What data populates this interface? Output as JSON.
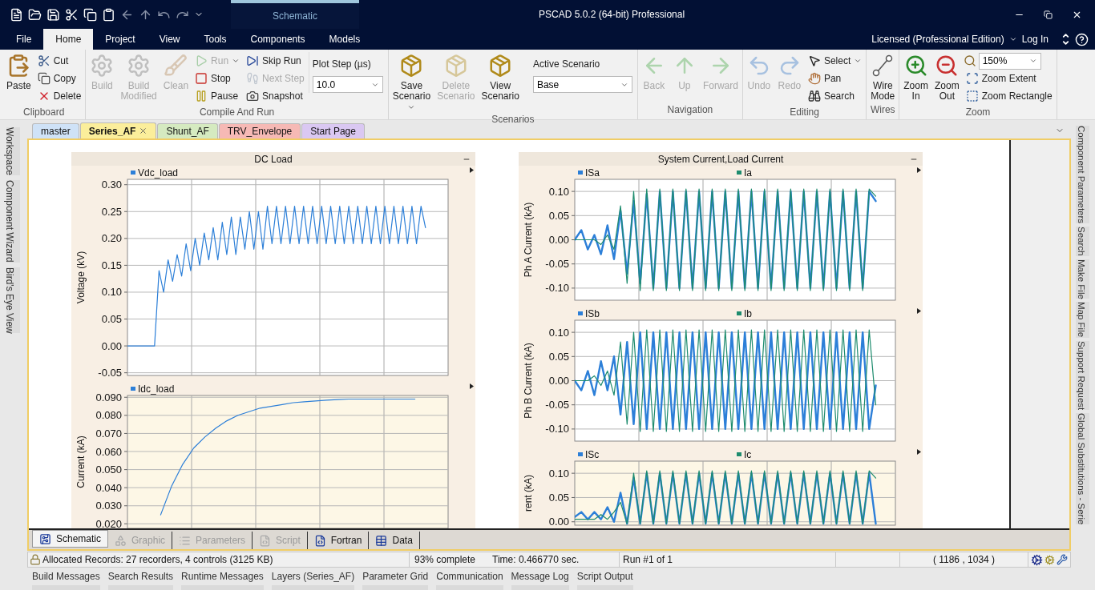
{
  "title_bar": {
    "context_tab": "Schematic",
    "title": "PSCAD 5.0.2 (64-bit) Professional"
  },
  "menu_tabs": [
    {
      "label": "File",
      "selected": false
    },
    {
      "label": "Home",
      "selected": true
    },
    {
      "label": "Project",
      "selected": false
    },
    {
      "label": "View",
      "selected": false
    },
    {
      "label": "Tools",
      "selected": false
    },
    {
      "label": "Components",
      "selected": false
    },
    {
      "label": "Models",
      "selected": false
    }
  ],
  "account": {
    "license": "Licensed (Professional Edition)",
    "login": "Log In"
  },
  "ribbon": {
    "groups": [
      {
        "label": "Clipboard",
        "items": [
          {
            "kind": "large",
            "label": "Paste",
            "disabled": false,
            "menu": false
          },
          {
            "kind": "column",
            "items": [
              {
                "kind": "small",
                "label": "Cut",
                "disabled": false,
                "menu": false
              },
              {
                "kind": "small",
                "label": "Copy",
                "disabled": false,
                "menu": false
              },
              {
                "kind": "small",
                "label": "Delete",
                "disabled": false,
                "menu": false
              }
            ]
          }
        ]
      },
      {
        "label": "Compile And Run",
        "items": [
          {
            "kind": "large",
            "label": "Build",
            "disabled": true,
            "menu": false
          },
          {
            "kind": "large",
            "label": "Build Modified",
            "disabled": true,
            "menu": false
          },
          {
            "kind": "large",
            "label": "Clean",
            "disabled": true,
            "menu": false
          },
          {
            "kind": "column",
            "items": [
              {
                "kind": "small",
                "label": "Run",
                "disabled": true,
                "menu": true
              },
              {
                "kind": "small",
                "label": "Stop",
                "disabled": false,
                "menu": false
              },
              {
                "kind": "small",
                "label": "Pause",
                "disabled": false,
                "menu": false
              }
            ]
          },
          {
            "kind": "column",
            "items": [
              {
                "kind": "small",
                "label": "Skip Run",
                "disabled": false,
                "menu": false
              },
              {
                "kind": "small",
                "label": "Next Step",
                "disabled": true,
                "menu": false
              },
              {
                "kind": "small",
                "label": "Snapshot",
                "disabled": false,
                "menu": false
              }
            ]
          },
          {
            "kind": "field",
            "label": "Plot Step (µs)",
            "value": "10.0"
          }
        ]
      },
      {
        "label": "Scenarios",
        "items": [
          {
            "kind": "large",
            "label": "Save Scenario",
            "disabled": false,
            "menu": true
          },
          {
            "kind": "large",
            "label": "Delete Scenario",
            "disabled": true,
            "menu": false
          },
          {
            "kind": "large",
            "label": "View Scenario",
            "disabled": false,
            "menu": false
          },
          {
            "kind": "field",
            "label": "Active Scenario",
            "value": "Base"
          }
        ]
      },
      {
        "label": "Navigation",
        "items": [
          {
            "kind": "large",
            "label": "Back",
            "disabled": true,
            "menu": false
          },
          {
            "kind": "large",
            "label": "Up",
            "disabled": true,
            "menu": false
          },
          {
            "kind": "large",
            "label": "Forward",
            "disabled": true,
            "menu": false
          }
        ]
      },
      {
        "label": "Editing",
        "items": [
          {
            "kind": "large",
            "label": "Undo",
            "disabled": true,
            "menu": false
          },
          {
            "kind": "large",
            "label": "Redo",
            "disabled": true,
            "menu": false
          },
          {
            "kind": "column",
            "items": [
              {
                "kind": "small",
                "label": "Select",
                "disabled": false,
                "menu": true
              },
              {
                "kind": "small",
                "label": "Pan",
                "disabled": false,
                "menu": false
              },
              {
                "kind": "small",
                "label": "Search",
                "disabled": false,
                "menu": false
              }
            ]
          }
        ]
      },
      {
        "label": "Wires",
        "items": [
          {
            "kind": "large",
            "label": "Wire Mode",
            "disabled": false,
            "menu": false
          }
        ]
      },
      {
        "label": "Zoom",
        "items": [
          {
            "kind": "large",
            "label": "Zoom In",
            "disabled": false,
            "menu": false
          },
          {
            "kind": "large",
            "label": "Zoom Out",
            "disabled": false,
            "menu": false
          },
          {
            "kind": "column",
            "items": [
              {
                "kind": "dropdown",
                "value": "150%"
              },
              {
                "kind": "small",
                "label": "Zoom Extent",
                "disabled": false,
                "menu": false
              },
              {
                "kind": "small",
                "label": "Zoom Rectangle",
                "disabled": false,
                "menu": false
              }
            ]
          }
        ]
      }
    ]
  },
  "doc_tabs": [
    {
      "label": "master",
      "selected": false,
      "color": "#cfe2f7"
    },
    {
      "label": "Series_AF",
      "selected": true,
      "color": "#fbee9b"
    },
    {
      "label": "Shunt_AF",
      "selected": false,
      "color": "#d5eac0"
    },
    {
      "label": "TRV_Envelope",
      "selected": false,
      "color": "#f6b9b5"
    },
    {
      "label": "Start Page",
      "selected": false,
      "color": "#dac8f2"
    }
  ],
  "left_sidebar": [
    "Workspace",
    "Component Wizard",
    "Bird's Eye View"
  ],
  "right_sidebar": [
    "Component Parameters",
    "Search",
    "Make File",
    "Map File",
    "Support Request",
    "Global Substitutions - Serie"
  ],
  "graph_frames": [
    {
      "title": "DC Load",
      "graphs": [
        {
          "selected": false,
          "chart_data": {
            "type": "line",
            "grid": true,
            "ylabel": "Voltage (kV)",
            "ylim": [
              -0.055,
              0.31
            ],
            "yticks": [
              {
                "value": 0.3,
                "label": "0.30"
              },
              {
                "value": 0.25,
                "label": "0.25"
              },
              {
                "value": 0.2,
                "label": "0.20"
              },
              {
                "value": 0.15,
                "label": "0.15"
              },
              {
                "value": 0.1,
                "label": "0.10"
              },
              {
                "value": 0.05,
                "label": "0.05"
              },
              {
                "value": 0,
                "label": "0.00"
              },
              {
                "value": -0.05,
                "label": "-0.05"
              }
            ],
            "series": [
              {
                "name": "Vdc_load",
                "color": "#2c7fd8",
                "values": [
                  0,
                  0,
                  0,
                  0,
                  0,
                  0,
                  0,
                  0.14,
                  0.1,
                  0.16,
                  0.12,
                  0.17,
                  0.13,
                  0.19,
                  0.14,
                  0.2,
                  0.15,
                  0.21,
                  0.16,
                  0.22,
                  0.16,
                  0.23,
                  0.17,
                  0.24,
                  0.17,
                  0.24,
                  0.18,
                  0.25,
                  0.18,
                  0.25,
                  0.18,
                  0.26,
                  0.19,
                  0.26,
                  0.19,
                  0.26,
                  0.19,
                  0.26,
                  0.19,
                  0.26,
                  0.19,
                  0.26,
                  0.19,
                  0.26,
                  0.19,
                  0.26,
                  0.19,
                  0.26,
                  0.19,
                  0.26,
                  0.19,
                  0.26,
                  0.19,
                  0.26,
                  0.19,
                  0.26,
                  0.19,
                  0.26,
                  0.19,
                  0.26,
                  0.19,
                  0.26,
                  0.19,
                  0.26,
                  0.19,
                  0.26,
                  0.22,
                  null,
                  null,
                  null,
                  null,
                  null
                ]
              }
            ]
          }
        },
        {
          "selected": true,
          "chart_data": {
            "type": "line",
            "grid": true,
            "ylabel": "Current (kA)",
            "ylim": [
              0.0175,
              0.091
            ],
            "yticks": [
              {
                "value": 0.09,
                "label": "0.090"
              },
              {
                "value": 0.08,
                "label": "0.080"
              },
              {
                "value": 0.07,
                "label": "0.070"
              },
              {
                "value": 0.06,
                "label": "0.060"
              },
              {
                "value": 0.05,
                "label": "0.050"
              },
              {
                "value": 0.04,
                "label": "0.040"
              },
              {
                "value": 0.03,
                "label": "0.030"
              },
              {
                "value": 0.02,
                "label": "0.020"
              }
            ],
            "series": [
              {
                "name": "Idc_load",
                "color": "#2c7fd8",
                "values": [
                  null,
                  null,
                  null,
                  0.025,
                  0.041,
                  0.053,
                  0.062,
                  0.068,
                  0.073,
                  0.077,
                  0.08,
                  0.082,
                  0.084,
                  0.085,
                  0.086,
                  0.087,
                  0.0875,
                  0.088,
                  0.0884,
                  0.0887,
                  0.089,
                  0.089,
                  0.089,
                  0.089,
                  0.089,
                  0.089,
                  0.089,
                  null,
                  null,
                  null
                ]
              }
            ]
          }
        }
      ]
    },
    {
      "title": "System Current,Load Current",
      "graphs": [
        {
          "selected": false,
          "chart_data": {
            "type": "line",
            "grid": true,
            "ylabel": "Ph A Current (kA)",
            "ylim": [
              -0.125,
              0.125
            ],
            "yticks": [
              {
                "value": 0.1,
                "label": "0.10"
              },
              {
                "value": 0.05,
                "label": "0.05"
              },
              {
                "value": 0,
                "label": "0.00"
              },
              {
                "value": -0.05,
                "label": "-0.05"
              },
              {
                "value": -0.1,
                "label": "-0.10"
              }
            ],
            "series": [
              {
                "name": "ISa",
                "color": "#2c7fd8",
                "values": [
                  0,
                  0.02,
                  -0.02,
                  0.01,
                  -0.03,
                  0.03,
                  -0.04,
                  0.06,
                  -0.07,
                  0.08,
                  -0.09,
                  0.095,
                  -0.1,
                  0.1,
                  -0.1,
                  0.1,
                  -0.1,
                  0.1,
                  -0.1,
                  0.1,
                  -0.1,
                  0.1,
                  -0.1,
                  0.1,
                  -0.1,
                  0.1,
                  -0.1,
                  0.1,
                  -0.1,
                  0.1,
                  -0.1,
                  0.1,
                  -0.1,
                  0.1,
                  -0.1,
                  0.1,
                  -0.1,
                  0.1,
                  -0.1,
                  0.1,
                  -0.1,
                  0.1,
                  -0.1,
                  0.1,
                  -0.1,
                  0.1,
                  0.08,
                  null,
                  null,
                  null
                ]
              },
              {
                "name": "Ia",
                "color": "#1e8c6e",
                "values": [
                  0,
                  0,
                  0,
                  0,
                  -0.01,
                  0.01,
                  -0.02,
                  0.07,
                  -0.09,
                  0.1,
                  -0.105,
                  0.105,
                  -0.105,
                  0.105,
                  -0.105,
                  0.105,
                  -0.105,
                  0.105,
                  -0.105,
                  0.105,
                  -0.105,
                  0.105,
                  -0.105,
                  0.105,
                  -0.105,
                  0.105,
                  -0.105,
                  0.105,
                  -0.105,
                  0.105,
                  -0.105,
                  0.105,
                  -0.105,
                  0.105,
                  -0.105,
                  0.105,
                  -0.105,
                  0.105,
                  -0.105,
                  0.105,
                  -0.105,
                  0.105,
                  -0.105,
                  0.105,
                  -0.105,
                  0.105,
                  0.09,
                  null,
                  null,
                  null
                ]
              }
            ]
          }
        },
        {
          "selected": false,
          "chart_data": {
            "type": "line",
            "grid": true,
            "ylabel": "Ph B Current (kA)",
            "ylim": [
              -0.125,
              0.125
            ],
            "yticks": [
              {
                "value": 0.1,
                "label": "0.10"
              },
              {
                "value": 0.05,
                "label": "0.05"
              },
              {
                "value": 0,
                "label": "0.00"
              },
              {
                "value": -0.05,
                "label": "-0.05"
              },
              {
                "value": -0.1,
                "label": "-0.10"
              }
            ],
            "series": [
              {
                "name": "ISb",
                "color": "#2c7fd8",
                "values": [
                  0,
                  -0.02,
                  0.02,
                  -0.03,
                  0.04,
                  -0.02,
                  0.05,
                  -0.07,
                  0.08,
                  -0.09,
                  0.1,
                  -0.1,
                  0.1,
                  -0.1,
                  0.1,
                  -0.1,
                  0.1,
                  -0.1,
                  0.1,
                  -0.1,
                  0.1,
                  -0.1,
                  0.1,
                  -0.1,
                  0.1,
                  -0.1,
                  0.1,
                  -0.1,
                  0.1,
                  -0.1,
                  0.1,
                  -0.1,
                  0.1,
                  -0.1,
                  0.1,
                  -0.1,
                  0.1,
                  -0.1,
                  0.1,
                  -0.1,
                  0.1,
                  -0.1,
                  0.1,
                  -0.1,
                  0.1,
                  -0.1,
                  -0.01,
                  null,
                  null,
                  null
                ]
              },
              {
                "name": "Ib",
                "color": "#1e8c6e",
                "values": [
                  0,
                  0,
                  0,
                  0.01,
                  -0.01,
                  0.02,
                  -0.03,
                  0.08,
                  -0.09,
                  0.1,
                  -0.105,
                  0.105,
                  -0.105,
                  0.105,
                  -0.105,
                  0.105,
                  -0.105,
                  0.105,
                  -0.105,
                  0.105,
                  -0.105,
                  0.105,
                  -0.105,
                  0.105,
                  -0.105,
                  0.105,
                  -0.105,
                  0.105,
                  -0.105,
                  0.105,
                  -0.105,
                  0.105,
                  -0.105,
                  0.105,
                  -0.105,
                  0.105,
                  -0.105,
                  0.105,
                  -0.105,
                  0.105,
                  -0.105,
                  0.105,
                  -0.105,
                  0.105,
                  -0.105,
                  0.105,
                  -0.05,
                  null,
                  null,
                  null
                ]
              }
            ]
          }
        },
        {
          "selected": true,
          "chart_data": {
            "type": "line",
            "grid": true,
            "ylabel": "rent (kA)",
            "ylim": [
              -0.007,
              0.125
            ],
            "yticks": [
              {
                "value": 0.1,
                "label": "0.10"
              },
              {
                "value": 0.05,
                "label": "0.05"
              },
              {
                "value": 0,
                "label": "0.00"
              }
            ],
            "series": [
              {
                "name": "ISc",
                "color": "#2c7fd8",
                "values": [
                  0.01,
                  0.02,
                  0.005,
                  0.02,
                  0.005,
                  0.03,
                  0.0,
                  0.06,
                  -0.004,
                  0.09,
                  -0.004,
                  0.1,
                  -0.004,
                  0.1,
                  -0.004,
                  0.1,
                  -0.004,
                  0.1,
                  -0.004,
                  0.1,
                  -0.004,
                  0.1,
                  -0.004,
                  0.1,
                  -0.004,
                  0.1,
                  -0.004,
                  0.1,
                  -0.004,
                  0.1,
                  -0.004,
                  0.1,
                  -0.004,
                  0.1,
                  -0.004,
                  0.1,
                  -0.004,
                  0.1,
                  -0.004,
                  0.1,
                  -0.004,
                  0.1,
                  -0.004,
                  0.1,
                  -0.004,
                  0.1,
                  -0.004,
                  null,
                  null,
                  null
                ]
              },
              {
                "name": "Ic",
                "color": "#1e8c6e",
                "values": [
                  0.005,
                  0.005,
                  0.005,
                  0.005,
                  0.015,
                  0.005,
                  0.02,
                  0.04,
                  -0.004,
                  0.1,
                  -0.004,
                  0.105,
                  -0.004,
                  0.105,
                  -0.004,
                  0.105,
                  -0.004,
                  0.105,
                  -0.004,
                  0.105,
                  -0.004,
                  0.105,
                  -0.004,
                  0.105,
                  -0.004,
                  0.105,
                  -0.004,
                  0.105,
                  -0.004,
                  0.105,
                  -0.004,
                  0.105,
                  -0.004,
                  0.105,
                  -0.004,
                  0.105,
                  -0.004,
                  0.105,
                  -0.004,
                  0.105,
                  -0.004,
                  0.105,
                  -0.004,
                  0.105,
                  -0.004,
                  0.105,
                  0.09,
                  null,
                  null,
                  null
                ]
              }
            ]
          }
        }
      ]
    }
  ],
  "view_tabs": [
    {
      "label": "Schematic",
      "selected": true,
      "disabled": false
    },
    {
      "label": "Graphic",
      "selected": false,
      "disabled": true
    },
    {
      "label": "Parameters",
      "selected": false,
      "disabled": true
    },
    {
      "label": "Script",
      "selected": false,
      "disabled": true
    },
    {
      "label": "Fortran",
      "selected": false,
      "disabled": false
    },
    {
      "label": "Data",
      "selected": false,
      "disabled": false
    }
  ],
  "status_bar": {
    "records": "Allocated Records: 27 recorders, 4 controls (3125 KB)",
    "progress": "93% complete",
    "time": "Time: 0.466770 sec.",
    "run": "Run #1 of 1",
    "coordinates": "( 1186 , 1034 )"
  },
  "panel_tabs": [
    "Build Messages",
    "Search Results",
    "Runtime Messages",
    "Layers (Series_AF)",
    "Parameter Grid",
    "Communication",
    "Message Log",
    "Script Output"
  ]
}
